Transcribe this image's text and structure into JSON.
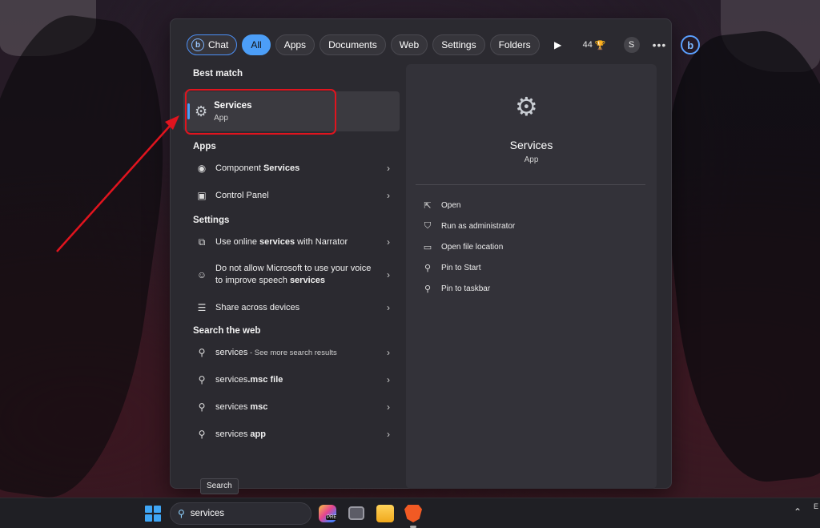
{
  "filters": {
    "chat": "Chat",
    "tabs": [
      "All",
      "Apps",
      "Documents",
      "Web",
      "Settings",
      "Folders"
    ],
    "active": "All",
    "points": "44",
    "avatar": "S"
  },
  "best_match": {
    "heading": "Best match",
    "title": "Services",
    "subtitle": "App"
  },
  "apps": {
    "heading": "Apps",
    "items": [
      {
        "pre": "Component ",
        "bold": "Services",
        "post": ""
      },
      {
        "pre": "Control Panel",
        "bold": "",
        "post": ""
      }
    ]
  },
  "settings": {
    "heading": "Settings",
    "items": [
      {
        "pre": "Use online ",
        "bold": "services",
        "post": " with Narrator"
      },
      {
        "pre": "Do not allow Microsoft to use your voice to improve speech ",
        "bold": "services",
        "post": ""
      },
      {
        "pre": "Share across devices",
        "bold": "",
        "post": ""
      }
    ]
  },
  "web": {
    "heading": "Search the web",
    "items": [
      {
        "pre": "services",
        "bold": "",
        "post": "",
        "small": " - See more search results"
      },
      {
        "pre": "services",
        "bold": ".msc file",
        "post": ""
      },
      {
        "pre": "services ",
        "bold": "msc",
        "post": ""
      },
      {
        "pre": "services ",
        "bold": "app",
        "post": ""
      }
    ]
  },
  "detail": {
    "name": "Services",
    "type": "App",
    "actions": [
      "Open",
      "Run as administrator",
      "Open file location",
      "Pin to Start",
      "Pin to taskbar"
    ]
  },
  "tooltip": "Search",
  "taskbar": {
    "search_value": "services",
    "copilot_badge": "PRE",
    "tray_text": "E"
  },
  "colors": {
    "accent": "#4c9ef7",
    "annotation": "#e0141e"
  }
}
